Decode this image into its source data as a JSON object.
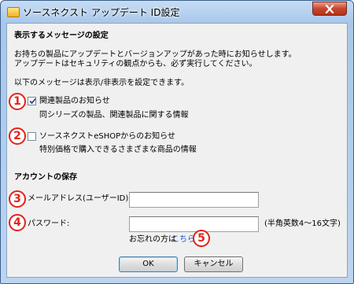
{
  "window": {
    "title": "ソースネクスト アップデート ID設定"
  },
  "display": {
    "heading": "表示するメッセージの設定",
    "description_line1": "お持ちの製品にアップデートとバージョンアップがあった時にお知らせします。",
    "description_line2": "アップデートはセキュリティの観点からも、必ず実行してください。",
    "note": "以下のメッセージは表示/非表示を設定できます。"
  },
  "options": [
    {
      "marker": "1",
      "label": "関連製品のお知らせ",
      "checked": true,
      "desc": "同シリーズの製品、関連製品に関する情報"
    },
    {
      "marker": "2",
      "label": "ソースネクストeSHOPからのお知らせ",
      "checked": false,
      "desc": "特別価格で購入できるさまざまな商品の情報"
    }
  ],
  "account": {
    "heading": "アカウントの保存",
    "email_marker": "3",
    "email_label": "メールアドレス(ユーザーID):",
    "email_value": "",
    "password_marker": "4",
    "password_label": "パスワード:",
    "password_value": "",
    "password_hint": "(半角英数4〜16文字)",
    "forgot_text": "お忘れの方は",
    "forgot_link": "こちら",
    "forgot_marker": "5"
  },
  "buttons": {
    "ok": "OK",
    "cancel": "キャンセル"
  },
  "colors": {
    "marker": "#e2231a",
    "link": "#1a56c9"
  }
}
